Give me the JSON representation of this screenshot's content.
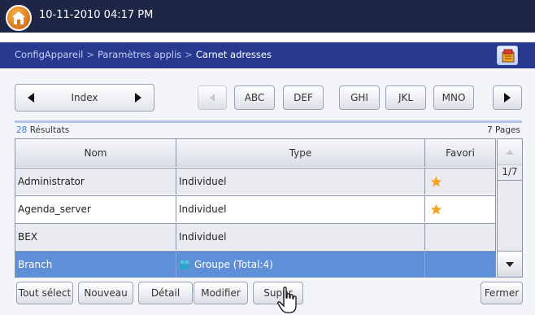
{
  "status": {
    "datetime": "10-11-2010 04:17 PM"
  },
  "breadcrumb": {
    "items": [
      "ConfigAppareil",
      "Paramètres applis",
      "Carnet adresses"
    ],
    "separator": ">"
  },
  "index": {
    "label": "Index"
  },
  "alpha_tabs": [
    "ABC",
    "DEF",
    "GHI",
    "JKL",
    "MNO"
  ],
  "results": {
    "count": "28",
    "label": "Résultats",
    "pages": "7 Pages"
  },
  "table": {
    "headers": {
      "nom": "Nom",
      "type": "Type",
      "favori": "Favori"
    },
    "rows": [
      {
        "nom": "Administrator",
        "type": "Individuel",
        "favori": true,
        "selected": false
      },
      {
        "nom": "Agenda_server",
        "type": "Individuel",
        "favori": true,
        "selected": false
      },
      {
        "nom": "BEX",
        "type": "Individuel",
        "favori": false,
        "selected": false
      },
      {
        "nom": "Branch",
        "type": "Groupe (Total:4)",
        "favori": false,
        "selected": true
      }
    ]
  },
  "scroll": {
    "page_indicator": "1/7"
  },
  "actions": {
    "select_all": "Tout sélect",
    "new": "Nouveau",
    "detail": "Détail",
    "modify": "Modifier",
    "delete": "Suppr",
    "close": "Fermer"
  },
  "colors": {
    "topbar": "#1d2644",
    "breadcrumb_bar": "#27398f",
    "selection": "#5f8fd6",
    "star": "#f5a51d"
  },
  "icons": [
    "home-icon",
    "address-book-icon",
    "arrow-left-icon",
    "arrow-right-icon",
    "scroll-up-icon",
    "scroll-down-icon",
    "star-icon",
    "group-icon",
    "hand-cursor-icon"
  ]
}
